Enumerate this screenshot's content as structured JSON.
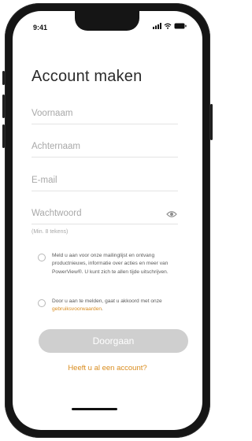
{
  "status_bar": {
    "time": "9:41"
  },
  "form": {
    "title": "Account maken",
    "firstname_placeholder": "Voornaam",
    "lastname_placeholder": "Achternaam",
    "email_placeholder": "E-mail",
    "password_placeholder": "Wachtwoord",
    "password_hint": "(Min. 8 tekens)"
  },
  "newsletter": {
    "text": "Meld u aan voor onze mailinglijst en ontvang productnieuws, informatie over acties en meer van PowerView®. U kunt zich te allen tijde uitschrijven."
  },
  "terms": {
    "text": "Door u aan te melden, gaat u akkoord met onze",
    "link_text": "gebruiksvoorwaarden",
    "suffix": "."
  },
  "continue_label": "Doorgaan",
  "login_link": "Heeft u al een account?",
  "colors": {
    "accent": "#d98c1e",
    "button_disabled": "#cfcfcf"
  }
}
